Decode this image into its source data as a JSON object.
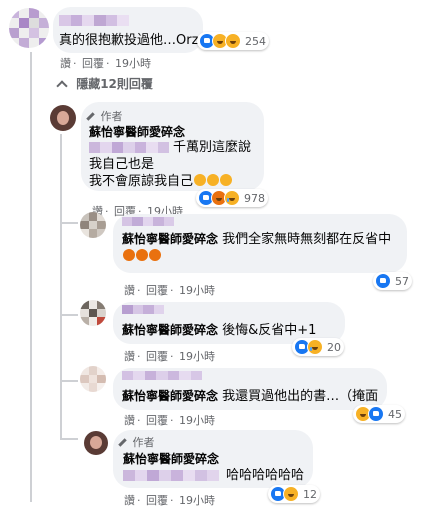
{
  "top_comment": {
    "text": "真的很抱歉投過他…Orz",
    "reaction_count": "254",
    "reactions": [
      "like-icon",
      "haha-icon",
      "wow-icon"
    ],
    "actions": {
      "like": "讚",
      "reply": "回覆",
      "time": "19小時"
    }
  },
  "hidden_replies": {
    "label": "隱藏12則回覆"
  },
  "replies": [
    {
      "author_tag": "作者",
      "name": "蘇怡寧醫師愛碎念",
      "line1_suffix": "千萬別這麼說",
      "line2": "我自己也是",
      "line3": "我不會原諒我自己",
      "emoji_names": [
        "crying-face-icon",
        "crying-face-icon",
        "crying-face-icon"
      ],
      "reaction_count": "978",
      "reactions": [
        "like-icon",
        "angry-icon",
        "sad-icon"
      ],
      "actions": {
        "like": "讚",
        "reply": "回覆",
        "time": "19小時"
      }
    },
    {
      "name": "蘇怡寧醫師愛碎念",
      "text": "我們全家無時無刻都在反省中",
      "emoji_names": [
        "angry-face-icon",
        "angry-face-icon",
        "angry-face-icon"
      ],
      "reaction_count": "57",
      "reactions": [
        "like-icon"
      ],
      "actions": {
        "like": "讚",
        "reply": "回覆",
        "time": "19小時"
      }
    },
    {
      "name": "蘇怡寧醫師愛碎念",
      "text": "後悔&反省中+1",
      "reaction_count": "20",
      "reactions": [
        "like-icon",
        "sad-icon"
      ],
      "actions": {
        "like": "讚",
        "reply": "回覆",
        "time": "19小時"
      }
    },
    {
      "name": "蘇怡寧醫師愛碎念",
      "text": "我還買過他出的書…（掩面",
      "reaction_count": "45",
      "reactions": [
        "haha-icon",
        "like-icon"
      ],
      "actions": {
        "like": "讚",
        "reply": "回覆",
        "time": "19小時"
      }
    },
    {
      "author_tag": "作者",
      "name": "蘇怡寧醫師愛碎念",
      "text": "哈哈哈哈哈哈",
      "reaction_count": "12",
      "reactions": [
        "like-icon",
        "haha-icon"
      ],
      "actions": {
        "like": "讚",
        "reply": "回覆",
        "time": "19小時"
      }
    }
  ],
  "colors": {
    "bubble": "#f0f2f5",
    "like": "#1877f2",
    "muted": "#65676b",
    "pixelated": "#c9b8d6"
  }
}
